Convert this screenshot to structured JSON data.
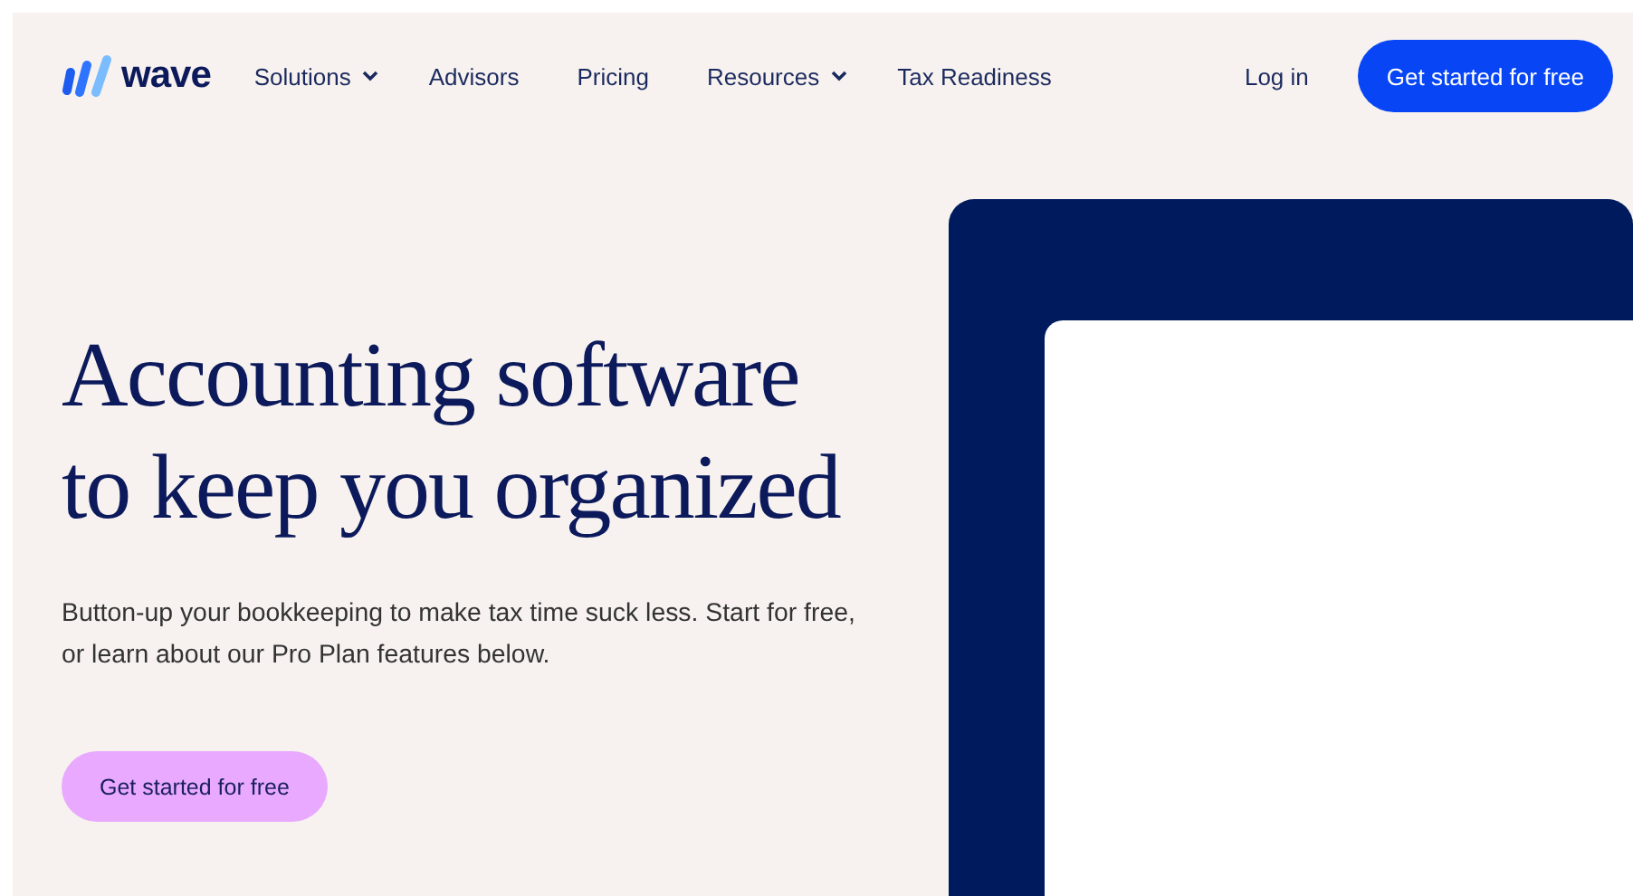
{
  "logo": {
    "text": "wave"
  },
  "nav": [
    {
      "label": "Solutions",
      "has_menu": true
    },
    {
      "label": "Advisors",
      "has_menu": false
    },
    {
      "label": "Pricing",
      "has_menu": false
    },
    {
      "label": "Resources",
      "has_menu": true
    },
    {
      "label": "Tax Readiness",
      "has_menu": false
    }
  ],
  "login": "Log in",
  "cta_header": "Get started for free",
  "hero": {
    "heading_lines": [
      "Accounting software",
      "to keep you organized"
    ],
    "lines": [
      "Button-up your bookkeeping to make tax time suck less. Start for free,",
      "or learn about our Pro Plan features below."
    ],
    "cta": "Get started for free"
  }
}
